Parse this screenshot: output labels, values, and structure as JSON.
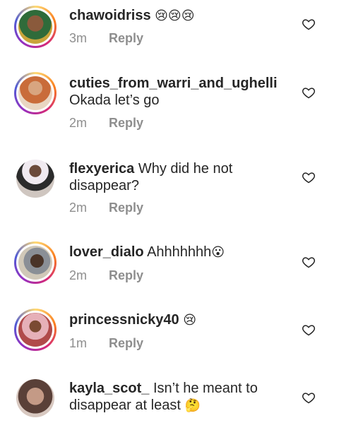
{
  "comments": [
    {
      "username": "chawoidriss",
      "text": "",
      "emoji": "😢😢😢",
      "time": "3m",
      "reply": "Reply",
      "avatar_color": "#3a5a2a",
      "ring": true
    },
    {
      "username": "cuties_from_warri_and_ughelli",
      "text": "Okada let’s go",
      "emoji": "",
      "time": "2m",
      "reply": "Reply",
      "avatar_color": "#c98f6a",
      "ring": true
    },
    {
      "username": "flexyerica",
      "text": "Why did he not disappear?",
      "emoji": "",
      "time": "2m",
      "reply": "Reply",
      "avatar_color": "#6b4a3a",
      "ring": false
    },
    {
      "username": "lover_dialo",
      "text": "Ahhhhhhh",
      "emoji": "😮",
      "time": "2m",
      "reply": "Reply",
      "avatar_color": "#4a3428",
      "ring": true
    },
    {
      "username": "princessnicky40",
      "text": "",
      "emoji": "😢",
      "time": "1m",
      "reply": "Reply",
      "avatar_color": "#b04a4a",
      "ring": true
    },
    {
      "username": "kayla_scot_",
      "text": "Isn’t he meant to disappear at least",
      "emoji": "🤔",
      "time": "",
      "reply": "",
      "avatar_color": "#5a4038",
      "ring": false
    }
  ]
}
